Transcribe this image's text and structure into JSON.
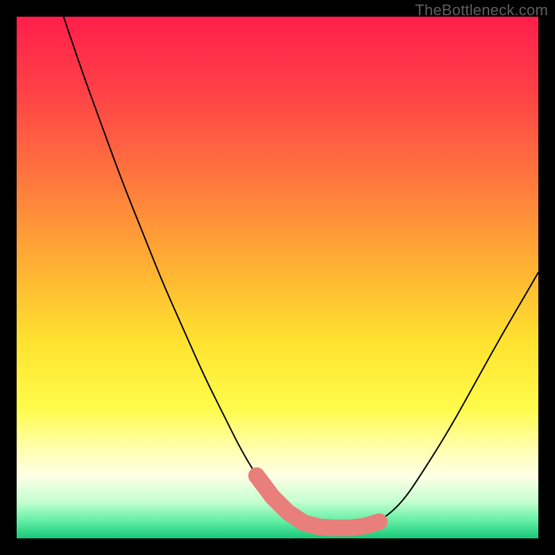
{
  "watermark": "TheBottleneck.com",
  "gradient_stops": [
    {
      "offset": 0.0,
      "color": "#ff1e4b"
    },
    {
      "offset": 0.15,
      "color": "#ff4346"
    },
    {
      "offset": 0.32,
      "color": "#ff7a3d"
    },
    {
      "offset": 0.48,
      "color": "#ffb133"
    },
    {
      "offset": 0.62,
      "color": "#ffe22f"
    },
    {
      "offset": 0.75,
      "color": "#fffb4a"
    },
    {
      "offset": 0.83,
      "color": "#ffffb0"
    },
    {
      "offset": 0.88,
      "color": "#ffffe6"
    },
    {
      "offset": 0.93,
      "color": "#c4ffd0"
    },
    {
      "offset": 0.965,
      "color": "#66f0a6"
    },
    {
      "offset": 1.0,
      "color": "#18c97a"
    }
  ],
  "chart_data": {
    "type": "line",
    "title": "",
    "xlabel": "",
    "ylabel": "",
    "xlim": [
      0,
      100
    ],
    "ylim": [
      0,
      100
    ],
    "grid": false,
    "legend": null,
    "series": [
      {
        "name": "curve",
        "stroke": "#000000",
        "stroke_width": 2.0,
        "x": [
          9,
          12,
          16,
          20,
          24,
          28,
          32,
          36,
          40,
          43,
          46,
          49,
          52,
          55,
          58,
          61,
          64,
          67,
          70,
          74,
          78,
          83,
          88,
          93,
          98,
          100
        ],
        "y": [
          100,
          91,
          80,
          69,
          59,
          49,
          40,
          31,
          23,
          17,
          12,
          8,
          5,
          3,
          2.2,
          2,
          2,
          2.4,
          3.5,
          7,
          13,
          21,
          30,
          39,
          47.5,
          51
        ]
      },
      {
        "name": "trough-markers",
        "type": "scatter",
        "stroke": "#e97f7a",
        "fill": "#e97f7a",
        "marker_radius_pct": 1.6,
        "x": [
          46,
          49,
          52,
          55,
          58,
          61,
          64,
          67,
          69.5
        ],
        "y": [
          12,
          8,
          5,
          3,
          2.2,
          2,
          2,
          2.4,
          3.2
        ]
      }
    ]
  }
}
